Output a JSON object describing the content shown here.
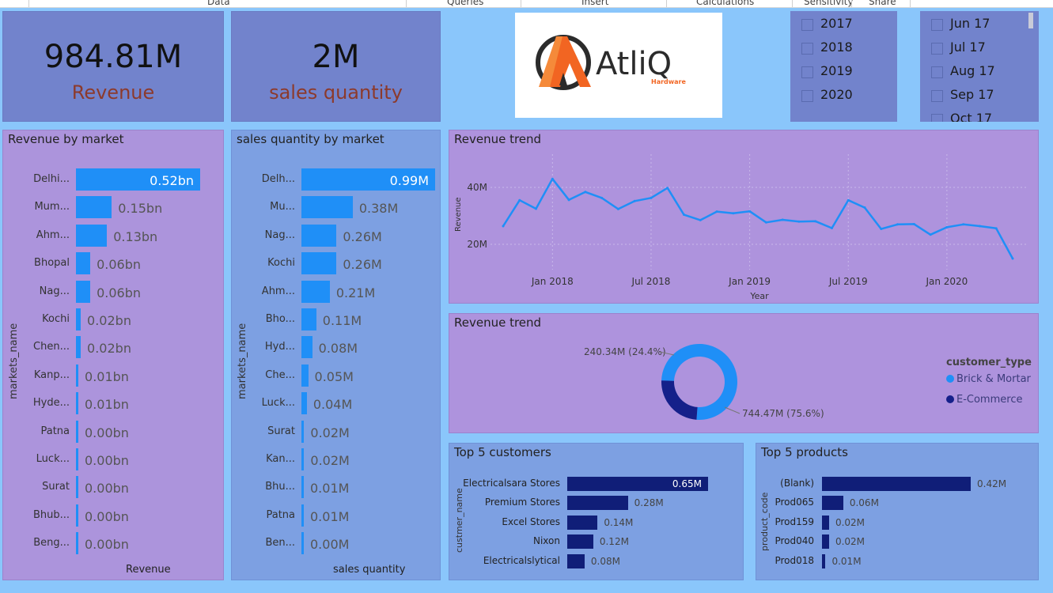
{
  "menu": {
    "items": [
      {
        "label": "Data"
      },
      {
        "label": "Queries"
      },
      {
        "label": "Insert"
      },
      {
        "label": "Calculations"
      },
      {
        "label": "Sensitivity"
      },
      {
        "label": "Share"
      }
    ]
  },
  "kpis": {
    "revenue": {
      "value": "984.81M",
      "label": "Revenue"
    },
    "quantity": {
      "value": "2M",
      "label": "sales quantity"
    }
  },
  "logo": {
    "brand": "AtliQ",
    "subtitle": "Hardware",
    "colors": {
      "primary": "#f26522",
      "dark": "#2b2b2b"
    }
  },
  "year_slicer": {
    "items": [
      {
        "label": "2017"
      },
      {
        "label": "2018"
      },
      {
        "label": "2019"
      },
      {
        "label": "2020"
      }
    ]
  },
  "month_slicer": {
    "items": [
      {
        "label": "Jun 17"
      },
      {
        "label": "Jul 17"
      },
      {
        "label": "Aug 17"
      },
      {
        "label": "Sep 17"
      },
      {
        "label": "Oct 17"
      }
    ]
  },
  "chart_data": [
    {
      "id": "revenue_by_market",
      "type": "bar",
      "orientation": "horizontal",
      "title": "Revenue by market",
      "ylabel": "markets_name",
      "xlabel": "Revenue",
      "categories": [
        "Delhi...",
        "Mum...",
        "Ahm...",
        "Bhopal",
        "Nag...",
        "Kochi",
        "Chen...",
        "Kanp...",
        "Hyde...",
        "Patna",
        "Luck...",
        "Surat",
        "Bhub...",
        "Beng..."
      ],
      "values": [
        0.52,
        0.15,
        0.13,
        0.06,
        0.06,
        0.02,
        0.02,
        0.01,
        0.01,
        0.0,
        0.0,
        0.0,
        0.0,
        0.0
      ],
      "labels": [
        "0.52bn",
        "0.15bn",
        "0.13bn",
        "0.06bn",
        "0.06bn",
        "0.02bn",
        "0.02bn",
        "0.01bn",
        "0.01bn",
        "0.00bn",
        "0.00bn",
        "0.00bn",
        "0.00bn",
        "0.00bn"
      ],
      "color": "#1f8ff7"
    },
    {
      "id": "quantity_by_market",
      "type": "bar",
      "orientation": "horizontal",
      "title": "sales quantity by market",
      "ylabel": "markets_name",
      "xlabel": "sales quantity",
      "categories": [
        "Delh...",
        "Mu...",
        "Nag...",
        "Kochi",
        "Ahm...",
        "Bho...",
        "Hyd...",
        "Che...",
        "Luck...",
        "Surat",
        "Kan...",
        "Bhu...",
        "Patna",
        "Ben..."
      ],
      "values": [
        0.99,
        0.38,
        0.26,
        0.26,
        0.21,
        0.11,
        0.08,
        0.05,
        0.04,
        0.02,
        0.02,
        0.01,
        0.01,
        0.0
      ],
      "labels": [
        "0.99M",
        "0.38M",
        "0.26M",
        "0.26M",
        "0.21M",
        "0.11M",
        "0.08M",
        "0.05M",
        "0.04M",
        "0.02M",
        "0.02M",
        "0.01M",
        "0.01M",
        "0.00M"
      ],
      "color": "#1f8ff7"
    },
    {
      "id": "revenue_trend_line",
      "type": "line",
      "title": "Revenue trend",
      "xlabel": "Year",
      "ylabel": "Revenue",
      "x": [
        "2017-10",
        "2017-11",
        "2017-12",
        "2018-01",
        "2018-02",
        "2018-03",
        "2018-04",
        "2018-05",
        "2018-06",
        "2018-07",
        "2018-08",
        "2018-09",
        "2018-10",
        "2018-11",
        "2018-12",
        "2019-01",
        "2019-02",
        "2019-03",
        "2019-04",
        "2019-05",
        "2019-06",
        "2019-07",
        "2019-08",
        "2019-09",
        "2019-10",
        "2019-11",
        "2019-12",
        "2020-01",
        "2020-02",
        "2020-03",
        "2020-04",
        "2020-05"
      ],
      "values": [
        26.4,
        35.5,
        32.5,
        43.0,
        35.6,
        38.4,
        36.3,
        32.4,
        35.2,
        36.3,
        39.8,
        30.4,
        28.5,
        31.5,
        30.9,
        31.6,
        27.7,
        28.6,
        28.0,
        28.1,
        25.7,
        35.5,
        32.9,
        25.4,
        27.0,
        27.1,
        23.4,
        26.0,
        27.0,
        26.4,
        25.6,
        15.0
      ],
      "x_ticks": [
        "Jan 2018",
        "Jul 2018",
        "Jan 2019",
        "Jul 2019",
        "Jan 2020"
      ],
      "y_ticks": [
        "20M",
        "40M"
      ],
      "unit": "M",
      "ylim": [
        12,
        47
      ],
      "color": "#1f8ff7",
      "grid": true
    },
    {
      "id": "revenue_trend_donut",
      "type": "pie",
      "style": "donut",
      "title": "Revenue trend",
      "legend_title": "customer_type",
      "legend_position": "right",
      "slices": [
        {
          "name": "Brick & Mortar",
          "value": 744.47,
          "percent": 75.6,
          "label": "744.47M (75.6%)",
          "color": "#1f8ff7"
        },
        {
          "name": "E-Commerce",
          "value": 240.34,
          "percent": 24.4,
          "label": "240.34M (24.4%)",
          "color": "#15208a"
        }
      ]
    },
    {
      "id": "top5_customers",
      "type": "bar",
      "orientation": "horizontal",
      "title": "Top 5 customers",
      "ylabel": "custmer_name",
      "categories": [
        "Electricalsara Stores",
        "Premium Stores",
        "Excel Stores",
        "Nixon",
        "Electricalslytical"
      ],
      "values": [
        0.65,
        0.28,
        0.14,
        0.12,
        0.08
      ],
      "labels": [
        "0.65M",
        "0.28M",
        "0.14M",
        "0.12M",
        "0.08M"
      ],
      "color": "#101e78"
    },
    {
      "id": "top5_products",
      "type": "bar",
      "orientation": "horizontal",
      "title": "Top 5 products",
      "ylabel": "product_code",
      "categories": [
        "(Blank)",
        "Prod065",
        "Prod159",
        "Prod040",
        "Prod018"
      ],
      "values": [
        0.42,
        0.06,
        0.02,
        0.02,
        0.01
      ],
      "labels": [
        "0.42M",
        "0.06M",
        "0.02M",
        "0.02M",
        "0.01M"
      ],
      "color": "#101e78"
    }
  ]
}
